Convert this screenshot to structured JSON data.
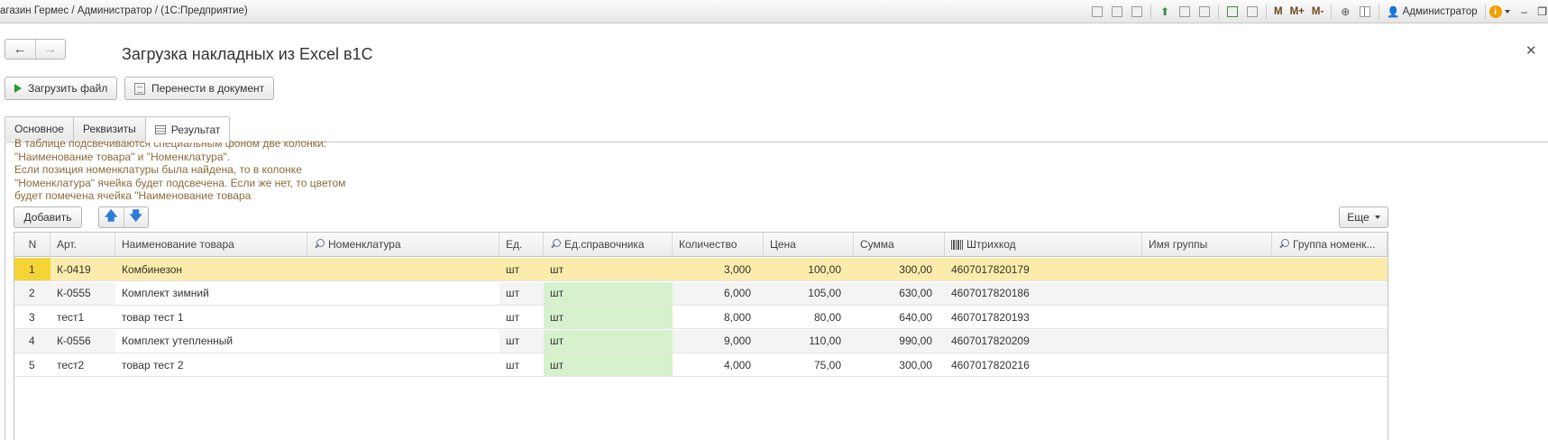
{
  "window": {
    "title": "агазин Гермес / Администратор /  (1С:Предприятие)",
    "user": "Администратор",
    "toolbar_icons": [
      "save-icon",
      "print-icon",
      "preview-icon",
      "upload-icon",
      "copy-icon",
      "attach-icon",
      "calculator-icon",
      "calendar-icon",
      "memory-m",
      "memory-plus",
      "memory-minus",
      "zoom-icon",
      "panel-icon"
    ],
    "memory_labels": [
      "M",
      "M+",
      "M-"
    ]
  },
  "form": {
    "title": "Загрузка накладных из Excel в1С"
  },
  "commands": {
    "load_file": "Загрузить файл",
    "transfer": "Перенести в документ"
  },
  "tabs": [
    {
      "label": "Основное",
      "active": false
    },
    {
      "label": "Реквизиты",
      "active": false
    },
    {
      "label": "Результат",
      "active": true
    }
  ],
  "hint": "В таблице подсвечиваются специальным фоном две колонки:\n\"Наименование товара\" и \"Номенклатура\".\nЕсли позиция номенклатуры была найдена, то в колонке\n\"Номенклатура\" ячейка будет подсвечена. Если же нет, то цветом\nбудет помечена ячейка \"Наименование товара",
  "table_toolbar": {
    "add": "Добавить",
    "more": "Еще"
  },
  "colors": {
    "selected_row": "#fcecab",
    "selected_number": "#f5d436",
    "found_highlight": "#d7f1cc",
    "hint_text": "#8b6b3a"
  },
  "table": {
    "columns": [
      "N",
      "Арт.",
      "Наименование товара",
      "Номенклатура",
      "Ед.",
      "Ед.справочника",
      "Количество",
      "Цена",
      "Сумма",
      "Штрихкод",
      "Имя группы",
      "Группа номенк..."
    ],
    "rows": [
      {
        "n": "1",
        "art": "К-0419",
        "name": "Комбинезон",
        "nom": "",
        "unit": "шт",
        "unit_ref": "шт",
        "qty": "3,000",
        "price": "100,00",
        "sum": "300,00",
        "barcode": "4607017820179",
        "group_name": "",
        "group": ""
      },
      {
        "n": "2",
        "art": "К-0555",
        "name": "Комплект зимний",
        "nom": "",
        "unit": "шт",
        "unit_ref": "шт",
        "qty": "6,000",
        "price": "105,00",
        "sum": "630,00",
        "barcode": "4607017820186",
        "group_name": "",
        "group": ""
      },
      {
        "n": "3",
        "art": "тест1",
        "name": "товар тест 1",
        "nom": "",
        "unit": "шт",
        "unit_ref": "шт",
        "qty": "8,000",
        "price": "80,00",
        "sum": "640,00",
        "barcode": "4607017820193",
        "group_name": "",
        "group": ""
      },
      {
        "n": "4",
        "art": "К-0556",
        "name": "Комплект утепленный",
        "nom": "",
        "unit": "шт",
        "unit_ref": "шт",
        "qty": "9,000",
        "price": "110,00",
        "sum": "990,00",
        "barcode": "4607017820209",
        "group_name": "",
        "group": ""
      },
      {
        "n": "5",
        "art": "тест2",
        "name": "товар тест 2",
        "nom": "",
        "unit": "шт",
        "unit_ref": "шт",
        "qty": "4,000",
        "price": "75,00",
        "sum": "300,00",
        "barcode": "4607017820216",
        "group_name": "",
        "group": ""
      }
    ]
  }
}
